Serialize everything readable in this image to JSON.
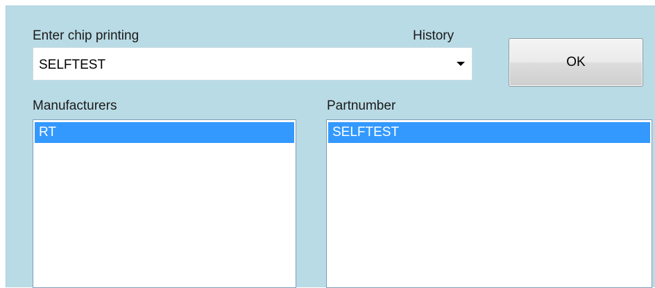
{
  "chip_printing": {
    "label": "Enter chip printing",
    "history_label": "History",
    "value": "SELFTEST"
  },
  "ok_button": {
    "label": "OK"
  },
  "manufacturers": {
    "label": "Manufacturers",
    "items": [
      "RT"
    ],
    "selected": "RT"
  },
  "partnumber": {
    "label": "Partnumber",
    "items": [
      "SELFTEST"
    ],
    "selected": "SELFTEST"
  },
  "colors": {
    "background": "#b9dbe5",
    "selection": "#3399ff"
  },
  "icons": {
    "combo_dropdown": "caret-down-icon"
  }
}
